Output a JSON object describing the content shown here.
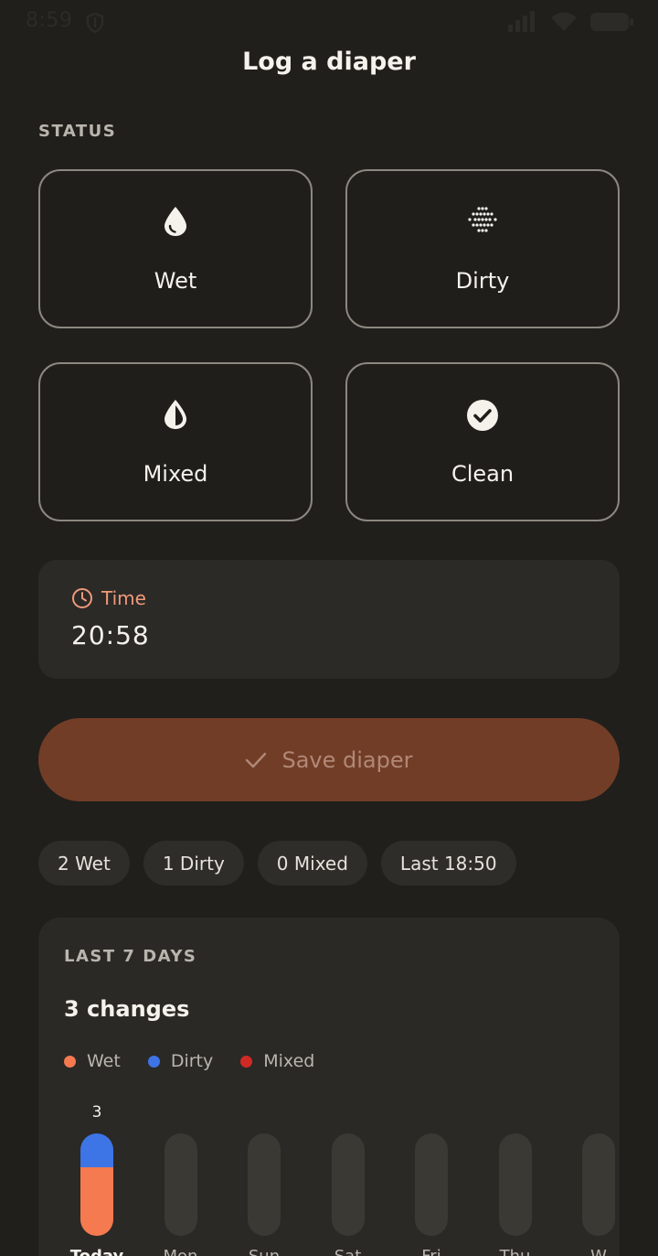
{
  "statusbar": {
    "time": "8:59"
  },
  "title": "Log a diaper",
  "status_section": {
    "label": "STATUS",
    "options": [
      {
        "label": "Wet",
        "icon": "droplet-icon"
      },
      {
        "label": "Dirty",
        "icon": "dots-grid-icon"
      },
      {
        "label": "Mixed",
        "icon": "half-droplet-icon"
      },
      {
        "label": "Clean",
        "icon": "check-circle-icon"
      }
    ]
  },
  "time_card": {
    "label": "Time",
    "value": "20:58"
  },
  "save_button": {
    "label": "Save diaper"
  },
  "chips": [
    "2 Wet",
    "1 Dirty",
    "0 Mixed",
    "Last 18:50"
  ],
  "week": {
    "label": "LAST 7 DAYS",
    "count": "3 changes",
    "legend": [
      {
        "name": "Wet",
        "color": "#f57a4f"
      },
      {
        "name": "Dirty",
        "color": "#3d74e6"
      },
      {
        "name": "Mixed",
        "color": "#cf2a24"
      }
    ]
  },
  "chart_data": {
    "type": "bar",
    "categories": [
      "Today",
      "Mon",
      "Sun",
      "Sat",
      "Fri",
      "Thu",
      "W"
    ],
    "series": [
      {
        "name": "Wet",
        "values": [
          2,
          0,
          0,
          0,
          0,
          0,
          0
        ]
      },
      {
        "name": "Dirty",
        "values": [
          1,
          0,
          0,
          0,
          0,
          0,
          0
        ]
      },
      {
        "name": "Mixed",
        "values": [
          0,
          0,
          0,
          0,
          0,
          0,
          0
        ]
      }
    ],
    "totals": [
      3,
      0,
      0,
      0,
      0,
      0,
      0
    ],
    "ylim": [
      0,
      3
    ],
    "colors": {
      "Wet": "#f57a4f",
      "Dirty": "#3d74e6",
      "Mixed": "#cf2a24",
      "empty": "#3a3933"
    }
  }
}
